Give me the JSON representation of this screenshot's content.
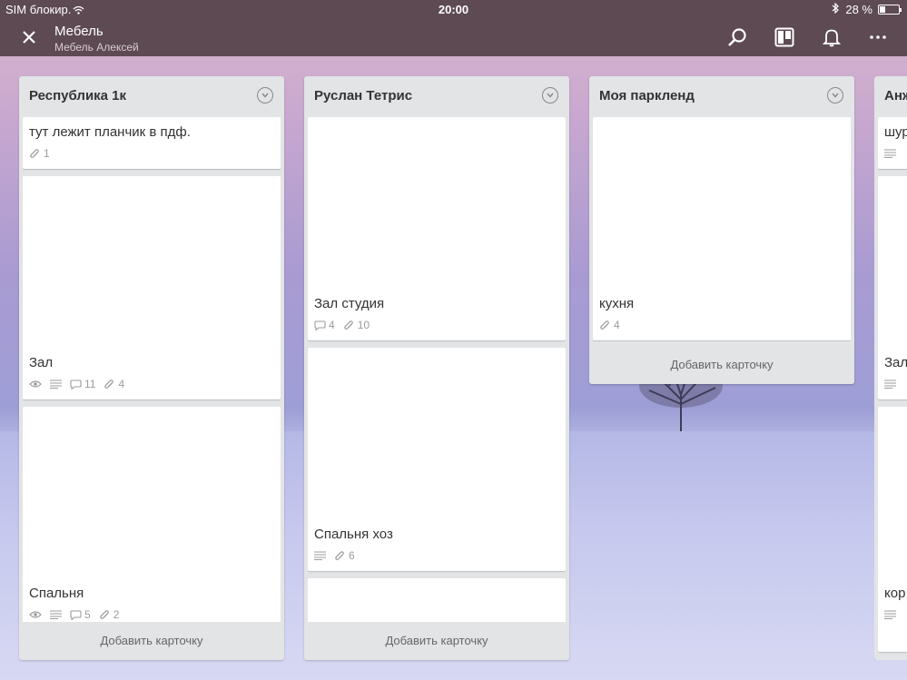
{
  "status": {
    "carrier": "SIM блокир.",
    "time": "20:00",
    "battery": "28 %",
    "battery_level": 0.28
  },
  "header": {
    "title": "Мебель",
    "subtitle": "Мебель Алексей"
  },
  "icons": [
    "close-icon",
    "search-icon",
    "board-view-icon",
    "bell-icon",
    "more-icon"
  ],
  "lists": [
    {
      "title": "Республика 1к",
      "add_label": "Добавить карточку",
      "cards": [
        {
          "title": "тут лежит планчик в пдф.",
          "attachments": "1"
        },
        {
          "title": "Зал",
          "comments": "11",
          "attachments": "4"
        },
        {
          "title": "Спальня",
          "comments": "5",
          "attachments": "2"
        }
      ]
    },
    {
      "title": "Руслан Тетрис",
      "add_label": "Добавить карточку",
      "cards": [
        {
          "title": "Зал студия",
          "comments": "4",
          "attachments": "10"
        },
        {
          "title": "Спальня хоз",
          "attachments": "6"
        },
        {
          "title": ""
        }
      ]
    },
    {
      "title": "Моя паркленд",
      "add_label": "Добавить карточку",
      "cards": [
        {
          "title": "кухня",
          "attachments": "4"
        }
      ]
    },
    {
      "title": "Анж",
      "cards": [
        {
          "title": "шур"
        },
        {
          "title": "Зал"
        },
        {
          "title": "кор"
        }
      ]
    }
  ]
}
